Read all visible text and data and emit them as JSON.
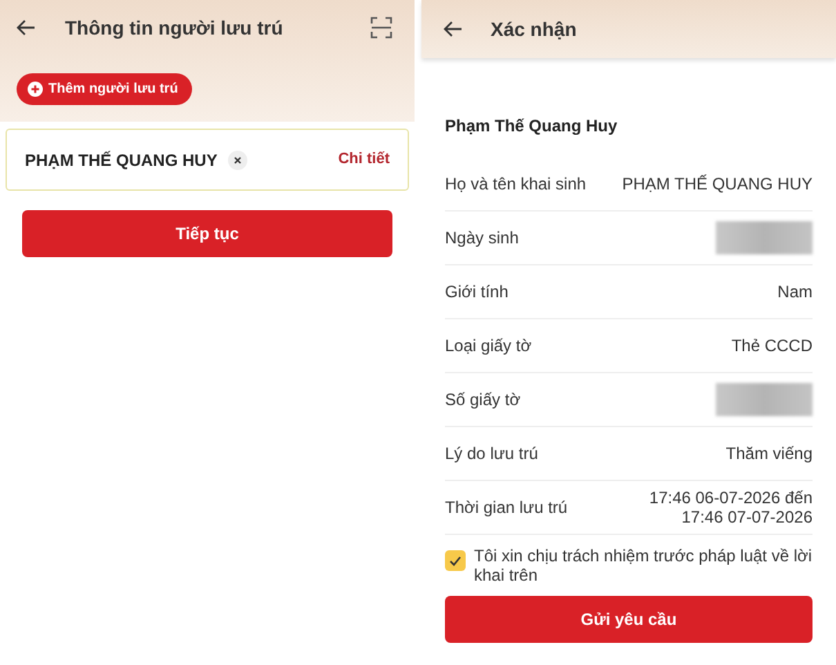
{
  "left_screen": {
    "title": "Thông tin người lưu trú",
    "add_button": "Thêm người lưu trú",
    "guest": {
      "name": "PHẠM THẾ QUANG HUY",
      "detail_link": "Chi tiết"
    },
    "continue_button": "Tiếp tục"
  },
  "right_screen": {
    "title": "Xác nhận",
    "guest_name": "Phạm Thế Quang Huy",
    "rows": [
      {
        "label": "Họ và tên khai sinh",
        "kind": "text",
        "value": "PHẠM THẾ QUANG HUY"
      },
      {
        "label": "Ngày sinh",
        "kind": "redacted"
      },
      {
        "label": "Giới tính",
        "kind": "text",
        "value": "Nam"
      },
      {
        "label": "Loại giấy tờ",
        "kind": "text",
        "value": "Thẻ CCCD"
      },
      {
        "label": "Số giấy tờ",
        "kind": "redacted"
      },
      {
        "label": "Lý do lưu trú",
        "kind": "text",
        "value": "Thăm viếng"
      },
      {
        "label": "Thời gian lưu trú",
        "kind": "multiline",
        "lines": [
          "17:46 06-07-2026 đến",
          "17:46 07-07-2026"
        ]
      }
    ],
    "agreement": {
      "text": "Tôi xin chịu trách nhiệm trước pháp luật về lời khai trên",
      "checked": true
    },
    "submit_button": "Gửi yêu cầu"
  }
}
